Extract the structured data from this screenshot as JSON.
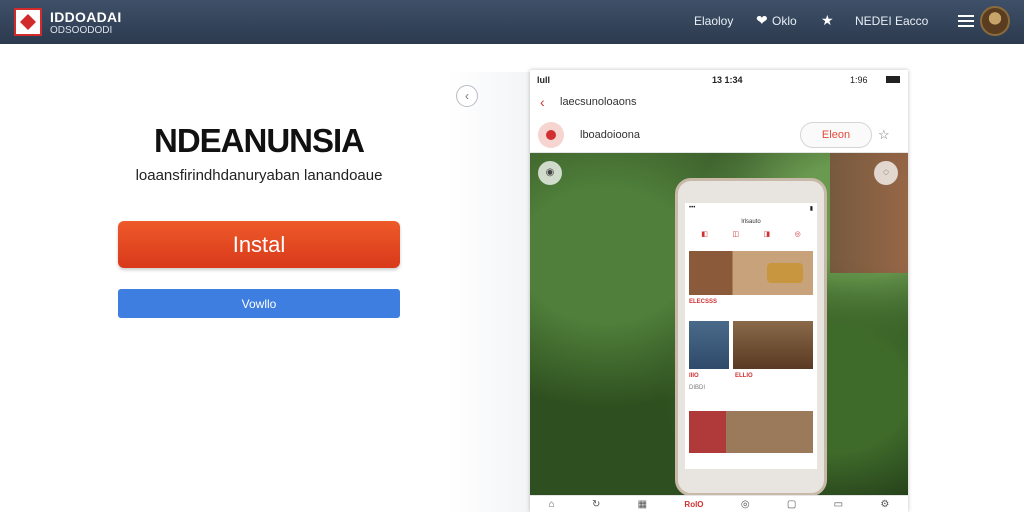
{
  "header": {
    "brand_title": "IDDOADAI",
    "brand_subtitle": "ODSOODODI",
    "nav": [
      {
        "label": "Elaoloy"
      },
      {
        "label": "Oklo"
      },
      {
        "label": "NEDEI Eacco"
      }
    ]
  },
  "listing": {
    "app_name": "NDEANUNSIA",
    "tagline": "loaansfirindhdanuryaban lanandoaue",
    "install_label": "Instal",
    "secondary_label": "Vowllo"
  },
  "phone": {
    "status": {
      "left": "lull",
      "center": "13 1:34",
      "right": "1:96"
    },
    "nav_title": "laecsunoloaons",
    "search_text": "lboadoioona",
    "open_label": "Eleon",
    "inner_title": "lrlsauto",
    "inner_labels": [
      "ELECSSS",
      "IIIO",
      "ELLIO",
      "DIBDI"
    ],
    "tabbar_label": "RolO"
  }
}
